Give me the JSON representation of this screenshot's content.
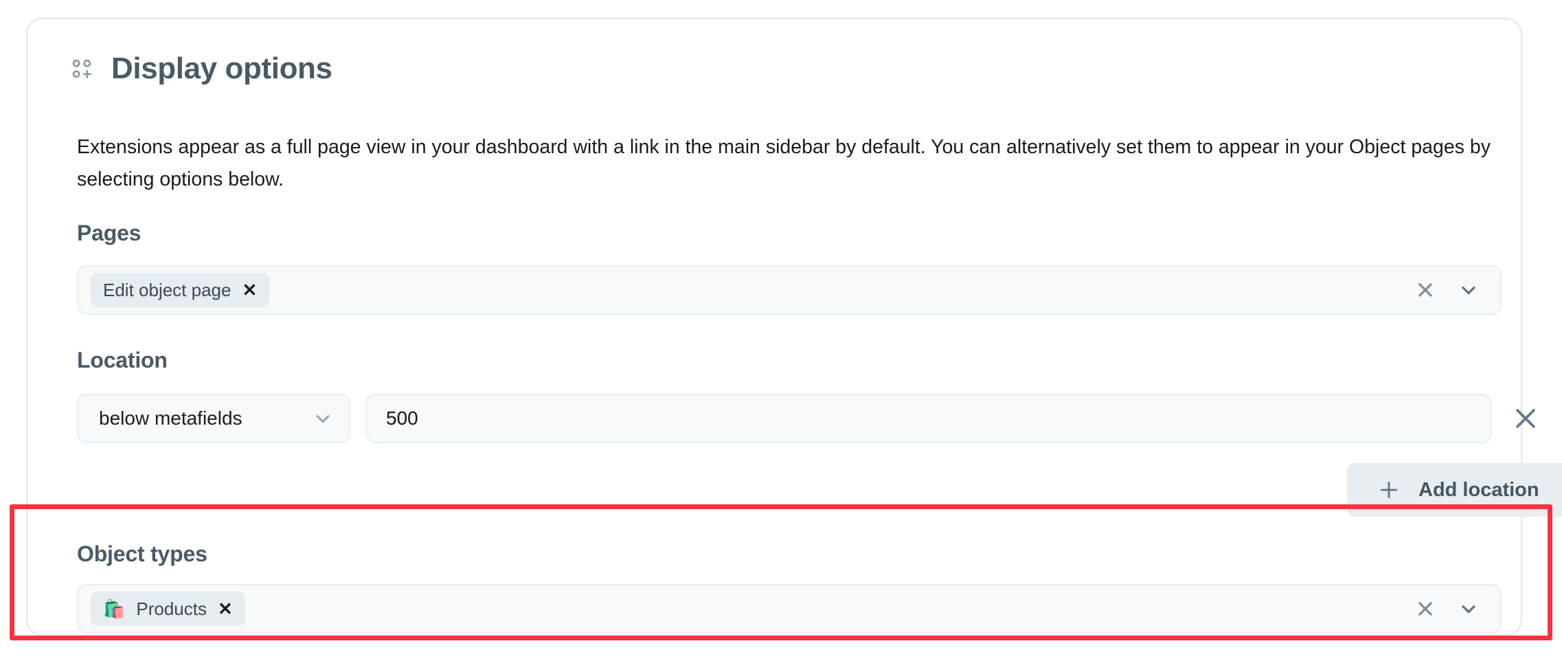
{
  "card": {
    "title": "Display options",
    "icon": "grid-plus-icon",
    "description": "Extensions appear as a full page view in your dashboard with a link in the main sidebar by default. You can alternatively set them to appear in your Object pages by selecting options below."
  },
  "pages": {
    "label": "Pages",
    "chips": [
      {
        "label": "Edit object page",
        "remove": "✕",
        "emoji": ""
      }
    ],
    "clear_icon": "clear-x-icon",
    "expand_icon": "chevron-down-icon"
  },
  "location": {
    "label": "Location",
    "dropdown_value": "below metafields",
    "dropdown_icon": "chevron-down-icon",
    "number_value": "500",
    "number_placeholder": "",
    "remove_icon": "remove-x-icon",
    "add_button_label": "Add location",
    "add_button_icon": "plus-icon"
  },
  "object_types": {
    "label": "Object types",
    "chips": [
      {
        "emoji": "🛍️",
        "label": "Products",
        "remove": "✕"
      }
    ],
    "clear_icon": "clear-x-icon",
    "expand_icon": "chevron-down-icon"
  },
  "annotation": {
    "highlight_color": "#f5333f"
  },
  "colors": {
    "heading": "#4a5a65",
    "field_bg": "#f7f9fb",
    "field_border": "#e8eef2",
    "chip_bg": "#e7ecf1",
    "button_bg": "#e8edf1",
    "icon_gray": "#7d8f9c",
    "card_border": "#dfe7ec",
    "body_text": "#1b1b1b"
  }
}
